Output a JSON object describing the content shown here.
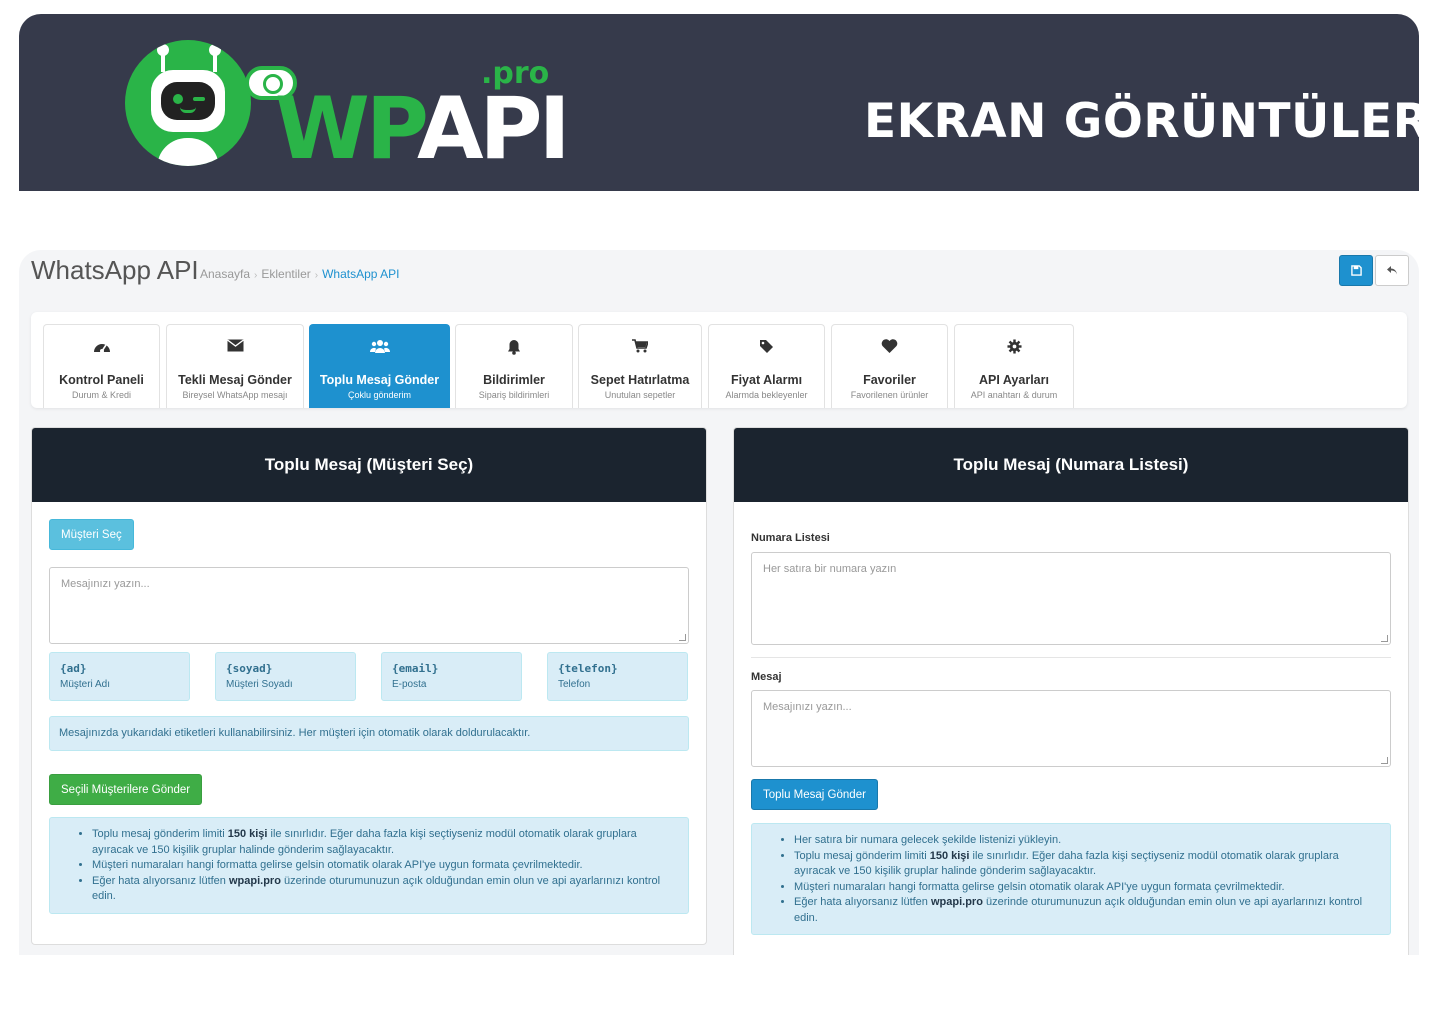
{
  "banner": {
    "logo_wp": "WP",
    "logo_api": "API",
    "logo_pro": ".pro",
    "title": "EKRAN GÖRÜNTÜLERI",
    "brand_green": "#2ab448",
    "background": "#363a4b"
  },
  "header": {
    "title": "WhatsApp API",
    "breadcrumb": [
      "Anasayfa",
      "Eklentiler",
      "WhatsApp API"
    ],
    "save_icon": "save-icon",
    "back_icon": "reply-icon"
  },
  "tabs": [
    {
      "icon": "dashboard-icon",
      "label": "Kontrol Paneli",
      "sub": "Durum & Kredi"
    },
    {
      "icon": "envelope-icon",
      "label": "Tekli Mesaj Gönder",
      "sub": "Bireysel WhatsApp mesajı"
    },
    {
      "icon": "users-icon",
      "label": "Toplu Mesaj Gönder",
      "sub": "Çoklu gönderim",
      "active": true
    },
    {
      "icon": "bell-icon",
      "label": "Bildirimler",
      "sub": "Sipariş bildirimleri"
    },
    {
      "icon": "cart-icon",
      "label": "Sepet Hatırlatma",
      "sub": "Unutulan sepetler"
    },
    {
      "icon": "tag-icon",
      "label": "Fiyat Alarmı",
      "sub": "Alarmda bekleyenler"
    },
    {
      "icon": "heart-icon",
      "label": "Favoriler",
      "sub": "Favorilenen ürünler"
    },
    {
      "icon": "gear-icon",
      "label": "API Ayarları",
      "sub": "API anahtarı & durum"
    }
  ],
  "left_panel": {
    "title": "Toplu Mesaj (Müşteri Seç)",
    "select_button": "Müşteri Seç",
    "message_placeholder": "Mesajınızı yazın...",
    "tags": [
      {
        "key": "{ad}",
        "desc": "Müşteri Adı"
      },
      {
        "key": "{soyad}",
        "desc": "Müşteri Soyadı"
      },
      {
        "key": "{email}",
        "desc": "E-posta"
      },
      {
        "key": "{telefon}",
        "desc": "Telefon"
      }
    ],
    "tag_info": "Mesajınızda yukarıdaki etiketleri kullanabilirsiniz. Her müşteri için otomatik olarak doldurulacaktır.",
    "send_button": "Seçili Müşterilere Gönder",
    "notes": {
      "n1_pre": "Toplu mesaj gönderim limiti ",
      "n1_bold": "150 kişi",
      "n1_post": " ile sınırlıdır. Eğer daha fazla kişi seçtiyseniz modül otomatik olarak gruplara ayıracak ve 150 kişilik gruplar halinde gönderim sağlayacaktır.",
      "n2": "Müşteri numaraları hangi formatta gelirse gelsin otomatik olarak API'ye uygun formata çevrilmektedir.",
      "n3_pre": "Eğer hata alıyorsanız lütfen ",
      "n3_bold": "wpapi.pro",
      "n3_post": " üzerinde oturumunuzun açık olduğundan emin olun ve api ayarlarınızı kontrol edin."
    }
  },
  "right_panel": {
    "title": "Toplu Mesaj (Numara Listesi)",
    "numbers_label": "Numara Listesi",
    "numbers_placeholder": "Her satıra bir numara yazın",
    "message_label": "Mesaj",
    "message_placeholder": "Mesajınızı yazın...",
    "send_button": "Toplu Mesaj Gönder",
    "notes": {
      "n0": "Her satıra bir numara gelecek şekilde listenizi yükleyin.",
      "n1_pre": "Toplu mesaj gönderim limiti ",
      "n1_bold": "150 kişi",
      "n1_post": " ile sınırlıdır. Eğer daha fazla kişi seçtiyseniz modül otomatik olarak gruplara ayıracak ve 150 kişilik gruplar halinde gönderim sağlayacaktır.",
      "n2": "Müşteri numaraları hangi formatta gelirse gelsin otomatik olarak API'ye uygun formata çevrilmektedir.",
      "n3_pre": "Eğer hata alıyorsanız lütfen ",
      "n3_bold": "wpapi.pro",
      "n3_post": " üzerinde oturumunuzun açık olduğundan emin olun ve api ayarlarınızı kontrol edin."
    }
  }
}
